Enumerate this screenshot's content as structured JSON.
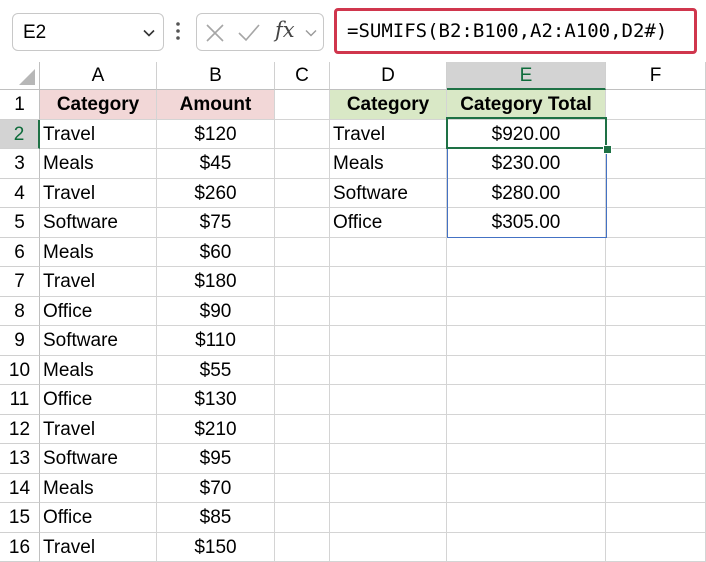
{
  "name_box": {
    "value": "E2"
  },
  "formula_bar": {
    "fx_label": "fx",
    "formula": "=SUMIFS(B2:B100,A2:A100,D2#)"
  },
  "columns": [
    "A",
    "B",
    "C",
    "D",
    "E",
    "F"
  ],
  "selected_column": "E",
  "rows": [
    "1",
    "2",
    "3",
    "4",
    "5",
    "6",
    "7",
    "8",
    "9",
    "10",
    "11",
    "12",
    "13",
    "14",
    "15",
    "16"
  ],
  "selected_row": "2",
  "source_table": {
    "headers": [
      "Category",
      "Amount"
    ],
    "rows": [
      [
        "Travel",
        "$120"
      ],
      [
        "Meals",
        "$45"
      ],
      [
        "Travel",
        "$260"
      ],
      [
        "Software",
        "$75"
      ],
      [
        "Meals",
        "$60"
      ],
      [
        "Travel",
        "$180"
      ],
      [
        "Office",
        "$90"
      ],
      [
        "Software",
        "$110"
      ],
      [
        "Meals",
        "$55"
      ],
      [
        "Office",
        "$130"
      ],
      [
        "Travel",
        "$210"
      ],
      [
        "Software",
        "$95"
      ],
      [
        "Meals",
        "$70"
      ],
      [
        "Office",
        "$85"
      ],
      [
        "Travel",
        "$150"
      ]
    ]
  },
  "summary_table": {
    "headers": [
      "Category",
      "Category Total"
    ],
    "rows": [
      [
        "Travel",
        "$920.00"
      ],
      [
        "Meals",
        "$230.00"
      ],
      [
        "Software",
        "$280.00"
      ],
      [
        "Office",
        "$305.00"
      ]
    ]
  },
  "colors": {
    "header_pink": "#f2d7d7",
    "header_green": "#d9e8c6",
    "selection_green": "#1e7145",
    "spill_blue": "#4472c4",
    "formula_highlight": "#d0364d"
  }
}
